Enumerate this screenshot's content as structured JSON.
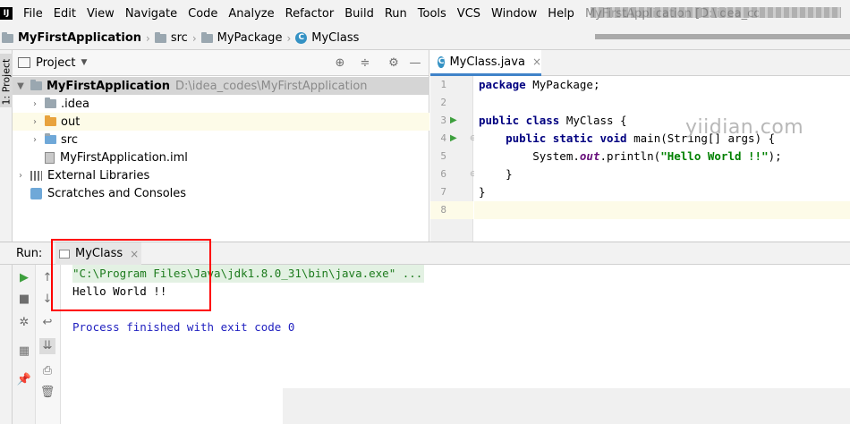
{
  "menubar": {
    "logo": "IJ",
    "items": [
      "File",
      "Edit",
      "View",
      "Navigate",
      "Code",
      "Analyze",
      "Refactor",
      "Build",
      "Run",
      "Tools",
      "VCS",
      "Window",
      "Help"
    ],
    "window_title": "MyFirstApplication [D:\\idea_codes\\MyFirstApplication]"
  },
  "breadcrumb": {
    "project": "MyFirstApplication",
    "src": "src",
    "package": "MyPackage",
    "class": "MyClass"
  },
  "left_strip": {
    "project_tab": "1: Project"
  },
  "project_panel": {
    "title": "Project",
    "tree": [
      {
        "label": "MyFirstApplication",
        "path": "D:\\idea_codes\\MyFirstApplication"
      },
      {
        "label": ".idea"
      },
      {
        "label": "out"
      },
      {
        "label": "src"
      },
      {
        "label": "MyFirstApplication.iml"
      },
      {
        "label": "External Libraries"
      },
      {
        "label": "Scratches and Consoles"
      }
    ]
  },
  "editor": {
    "tab_label": "MyClass.java",
    "line_numbers": [
      "1",
      "2",
      "3",
      "4",
      "5",
      "6",
      "7",
      "8"
    ],
    "code": {
      "l1_kw": "package",
      "l1_rest": " MyPackage;",
      "l3_kw1": "public",
      "l3_kw2": " class",
      "l3_rest": " MyClass {",
      "l4_indent": "    ",
      "l4_kw1": "public",
      "l4_kw2": " static",
      "l4_kw3": " void",
      "l4_rest": " main(String[] args) {",
      "l5_pre": "        System.",
      "l5_field": "out",
      "l5_mid": ".println(",
      "l5_str": "\"Hello World !!\"",
      "l5_end": ");",
      "l6": "    }",
      "l7": "}"
    },
    "watermark": "yiidian.com"
  },
  "run_window": {
    "label": "Run:",
    "tab_label": "MyClass",
    "console": {
      "command": "\"C:\\Program Files\\Java\\jdk1.8.0_31\\bin\\java.exe\" ...",
      "output": "Hello World !!",
      "exit": "Process finished with exit code 0"
    }
  },
  "colors": {
    "accent": "#4083c9",
    "annotation_box": "#ff0000",
    "keyword": "#000080",
    "string": "#008000",
    "console_exit": "#1f1fbf"
  }
}
